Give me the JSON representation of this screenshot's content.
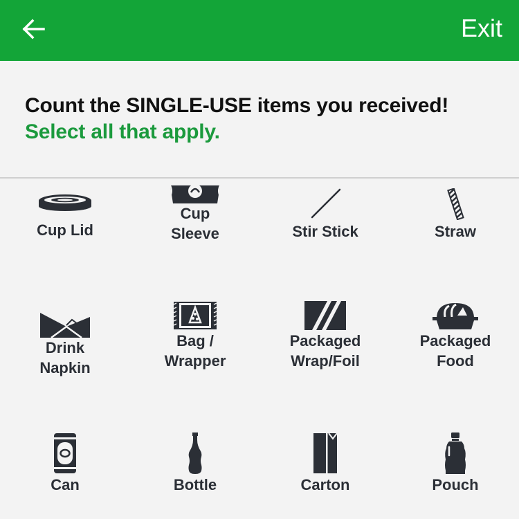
{
  "topbar": {
    "background_color": "#13a538",
    "back_icon": "arrow-left-icon",
    "exit_label": "Exit"
  },
  "header": {
    "title": "Count the SINGLE-USE items you received!",
    "subtitle": "Select all that apply."
  },
  "items": [
    {
      "label_line1": "Cup Lid",
      "label_line2": "",
      "icon": "cup-lid-icon"
    },
    {
      "label_line1": "Cup",
      "label_line2": "Sleeve",
      "icon": "cup-sleeve-icon"
    },
    {
      "label_line1": "Stir Stick",
      "label_line2": "",
      "icon": "stir-stick-icon"
    },
    {
      "label_line1": "Straw",
      "label_line2": "",
      "icon": "straw-icon"
    },
    {
      "label_line1": "Drink",
      "label_line2": "Napkin",
      "icon": "napkin-icon"
    },
    {
      "label_line1": "Bag /",
      "label_line2": "Wrapper",
      "icon": "bag-wrapper-icon"
    },
    {
      "label_line1": "Packaged",
      "label_line2": "Wrap/Foil",
      "icon": "wrap-foil-icon"
    },
    {
      "label_line1": "Packaged",
      "label_line2": "Food",
      "icon": "food-container-icon"
    },
    {
      "label_line1": "Can",
      "label_line2": "",
      "icon": "can-icon"
    },
    {
      "label_line1": "Bottle",
      "label_line2": "",
      "icon": "bottle-icon"
    },
    {
      "label_line1": "Carton",
      "label_line2": "",
      "icon": "carton-icon"
    },
    {
      "label_line1": "Pouch",
      "label_line2": "",
      "icon": "pouch-icon"
    }
  ],
  "colors": {
    "accent_green": "#13a538",
    "subtitle_green": "#1b9a3d",
    "icon_dark": "#2b2f36"
  }
}
